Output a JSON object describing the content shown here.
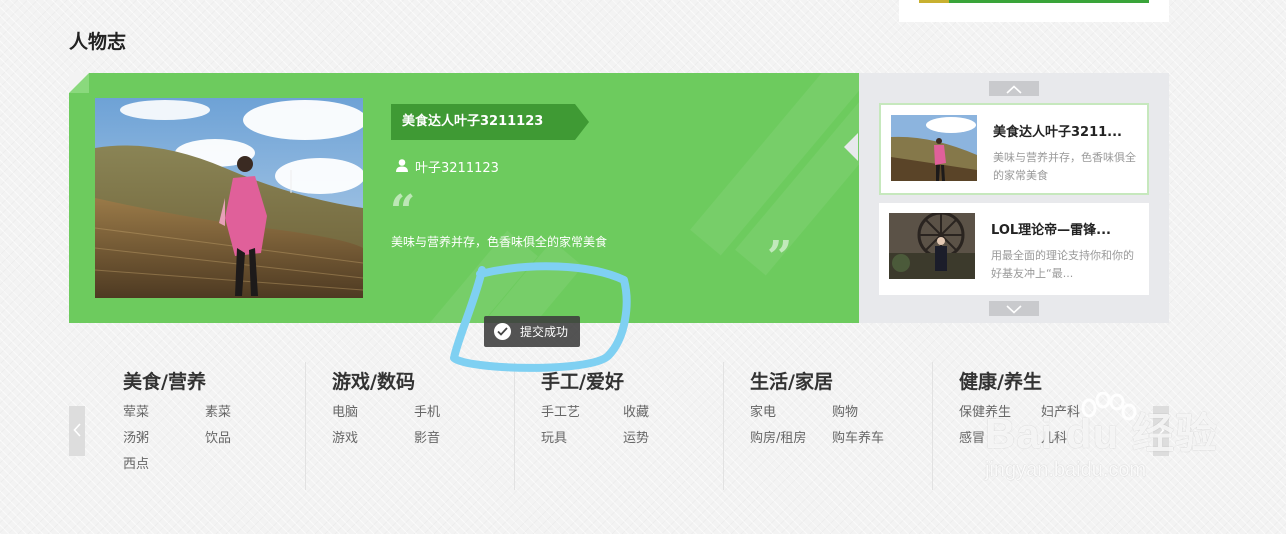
{
  "section": {
    "title": "人物志"
  },
  "feature": {
    "name_tag": "美食达人叶子3211123",
    "author": "叶子3211123",
    "quote_open": "“",
    "quote_close": "”",
    "description": "美味与营养并存，色香味俱全的家常美食"
  },
  "side_list": [
    {
      "title": "美食达人叶子3211...",
      "desc": "美味与营养并存，色香味俱全的家常美食",
      "active": true
    },
    {
      "title": "LOL理论帝—雷锋...",
      "desc": "用最全面的理论支持你和你的好基友冲上“最...",
      "active": false
    }
  ],
  "toast": {
    "text": "提交成功"
  },
  "categories": [
    {
      "title": "美食/营养",
      "links": [
        "荤菜",
        "素菜",
        "汤粥",
        "饮品",
        "西点"
      ]
    },
    {
      "title": "游戏/数码",
      "links": [
        "电脑",
        "手机",
        "游戏",
        "影音"
      ]
    },
    {
      "title": "手工/爱好",
      "links": [
        "手工艺",
        "收藏",
        "玩具",
        "运势"
      ]
    },
    {
      "title": "生活/家居",
      "links": [
        "家电",
        "购物",
        "购房/租房",
        "购车养车"
      ]
    },
    {
      "title": "健康/养生",
      "links": [
        "保健养生",
        "妇产科",
        "感冒",
        "儿科"
      ]
    }
  ],
  "watermark": {
    "main": "Bai du 经验",
    "sub": "jingyan.baidu.com"
  },
  "colors": {
    "feature_green": "#6dcb5e",
    "ribbon_green": "#3f9a34",
    "side_bg": "#e8e9ec",
    "scribble_blue": "#7fd0f2"
  },
  "icons": [
    "user-icon",
    "chevron-up-icon",
    "chevron-down-icon",
    "check-icon",
    "chevron-left-icon",
    "chevron-right-icon",
    "baidu-paw-icon"
  ]
}
